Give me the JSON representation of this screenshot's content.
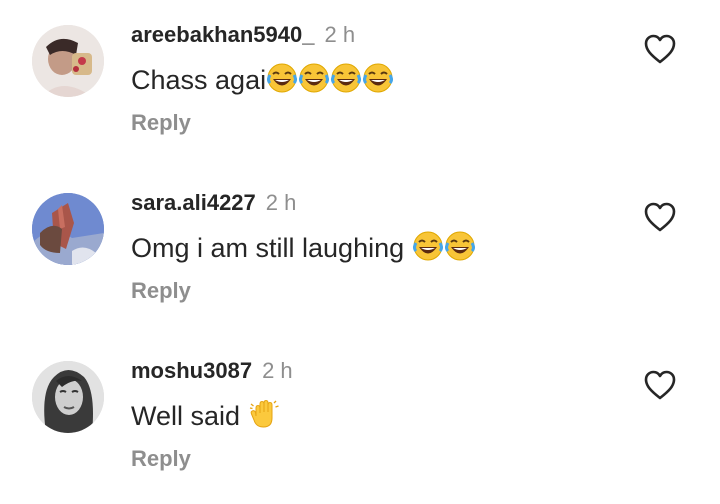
{
  "comments": [
    {
      "username": "areebakhan5940_",
      "time": "2 h",
      "text": "Chass agai",
      "emojis": [
        "joy-emoji",
        "joy-emoji",
        "joy-emoji",
        "joy-emoji"
      ],
      "reply_label": "Reply"
    },
    {
      "username": "sara.ali4227",
      "time": "2 h",
      "text": "Omg i am still laughing ",
      "emojis": [
        "joy-emoji",
        "joy-emoji"
      ],
      "reply_label": "Reply"
    },
    {
      "username": "moshu3087",
      "time": "2 h",
      "text": "Well said ",
      "emojis": [
        "waving-hand-emoji"
      ],
      "reply_label": "Reply"
    }
  ],
  "colors": {
    "username": "#262626",
    "secondary": "#8e8e8e",
    "icon": "#262626"
  }
}
